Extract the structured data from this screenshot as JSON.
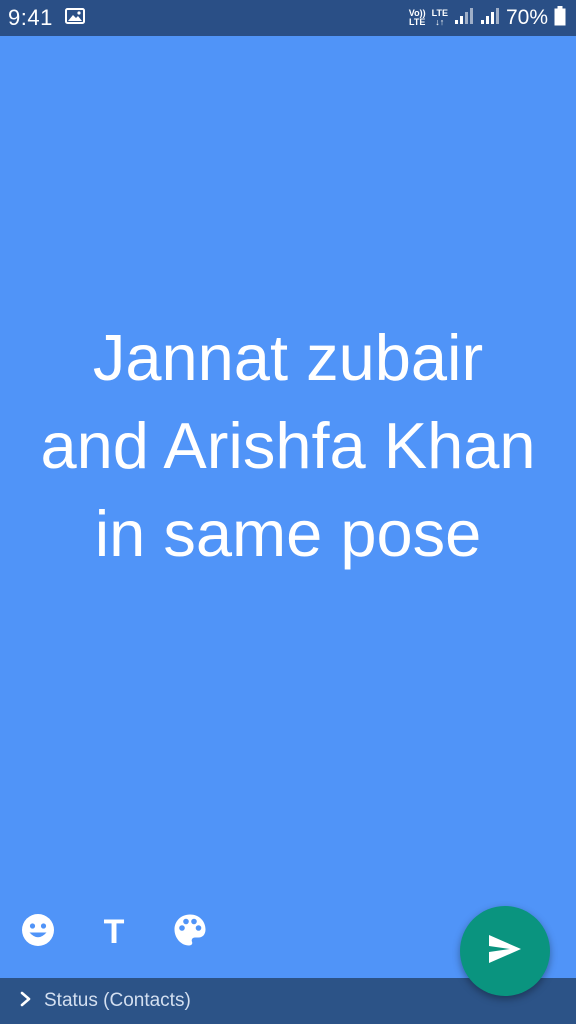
{
  "status_bar": {
    "time": "9:41",
    "volte_top": "Vo))",
    "volte_bottom": "LTE",
    "lte_top": "LTE",
    "lte_bottom": "↓↑",
    "battery_percent": "70%"
  },
  "status_update": {
    "text": "Jannat zubair and Arishfa Khan in same pose",
    "background_color": "#5094f8"
  },
  "tools": {
    "emoji_icon": "smiley-icon",
    "text_label": "T",
    "palette_icon": "palette-icon"
  },
  "send_button": {
    "icon": "send-icon",
    "color": "#0a947f"
  },
  "audience": {
    "label": "Status (Contacts)"
  }
}
